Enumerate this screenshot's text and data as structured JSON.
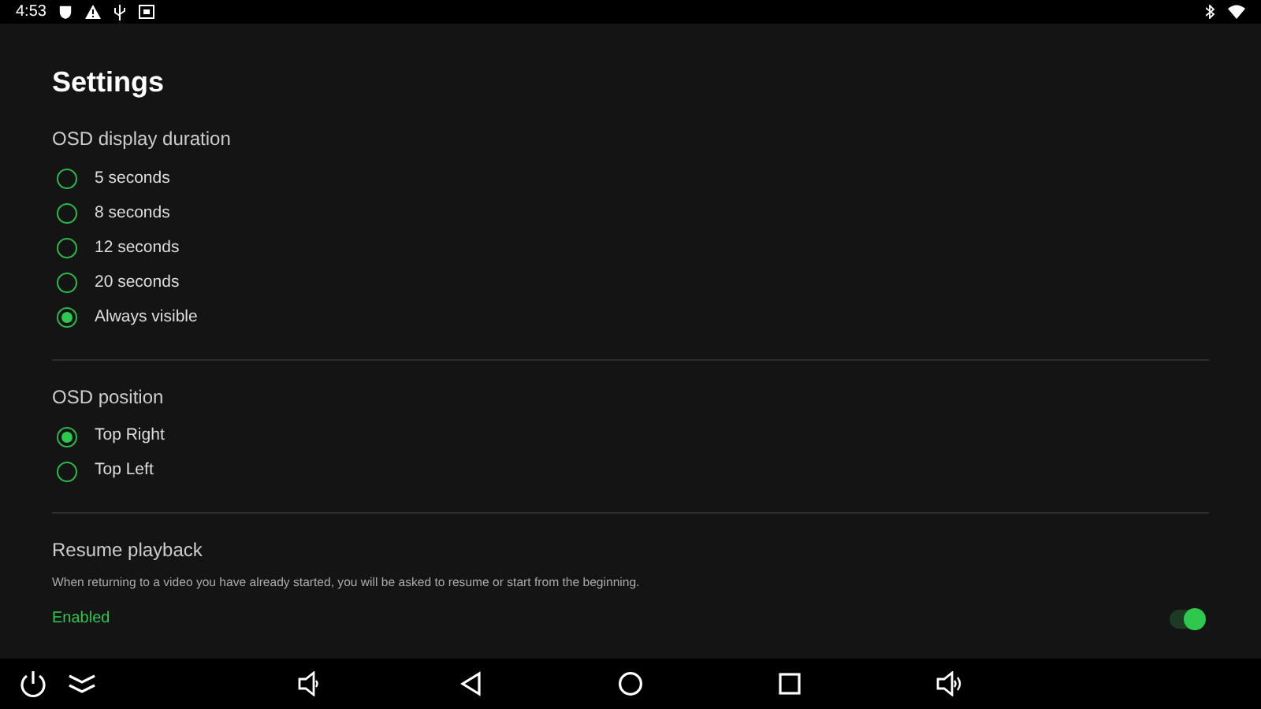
{
  "status_bar": {
    "time": "4:53"
  },
  "title": "Settings",
  "sections": [
    {
      "heading": "OSD display duration",
      "options": [
        {
          "label": "5 seconds",
          "selected": false
        },
        {
          "label": "8 seconds",
          "selected": false
        },
        {
          "label": "12 seconds",
          "selected": false
        },
        {
          "label": "20 seconds",
          "selected": false
        },
        {
          "label": "Always visible",
          "selected": true
        }
      ]
    },
    {
      "heading": "OSD position",
      "options": [
        {
          "label": "Top Right",
          "selected": true
        },
        {
          "label": "Top Left",
          "selected": false
        }
      ]
    }
  ],
  "resume_playback": {
    "heading": "Resume playback",
    "description": "When returning to a video you have already started, you will be asked to resume or start from the beginning.",
    "value": "Enabled",
    "on": true
  }
}
